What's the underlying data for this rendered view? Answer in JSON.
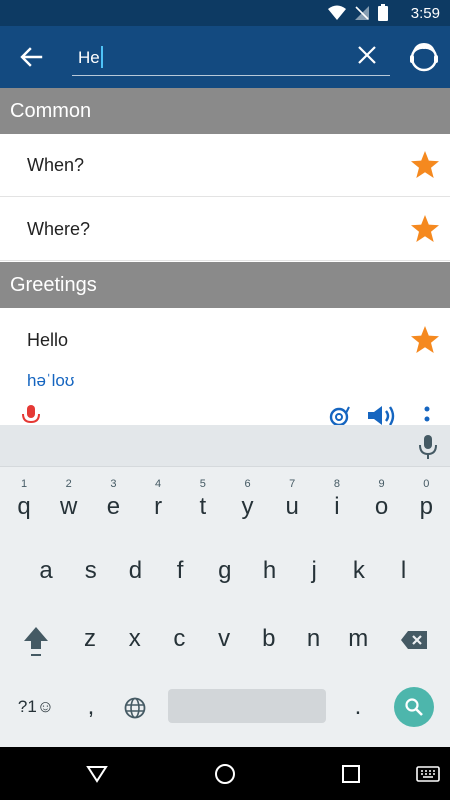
{
  "status_bar": {
    "time": "3:59"
  },
  "search": {
    "value": "He"
  },
  "sections": [
    {
      "title": "Common",
      "items": [
        {
          "label": "When?"
        },
        {
          "label": "Where?"
        }
      ]
    },
    {
      "title": "Greetings",
      "items": [
        {
          "label": "Hello",
          "phonetic": "həˈloʊ"
        }
      ]
    }
  ],
  "keyboard": {
    "row1": [
      {
        "ch": "q",
        "hint": "1"
      },
      {
        "ch": "w",
        "hint": "2"
      },
      {
        "ch": "e",
        "hint": "3"
      },
      {
        "ch": "r",
        "hint": "4"
      },
      {
        "ch": "t",
        "hint": "5"
      },
      {
        "ch": "y",
        "hint": "6"
      },
      {
        "ch": "u",
        "hint": "7"
      },
      {
        "ch": "i",
        "hint": "8"
      },
      {
        "ch": "o",
        "hint": "9"
      },
      {
        "ch": "p",
        "hint": "0"
      }
    ],
    "row2": [
      "a",
      "s",
      "d",
      "f",
      "g",
      "h",
      "j",
      "k",
      "l"
    ],
    "row3": [
      "z",
      "x",
      "c",
      "v",
      "b",
      "n",
      "m"
    ],
    "symbols_label": "?1☺",
    "comma": ",",
    "period": "."
  },
  "colors": {
    "status_bar": "#0d3a63",
    "app_bar": "#134a80",
    "section_header": "#8a8a8a",
    "star": "#f5891f",
    "phonetic": "#1565c0",
    "mic": "#e53935",
    "search_key": "#4db6ac"
  }
}
